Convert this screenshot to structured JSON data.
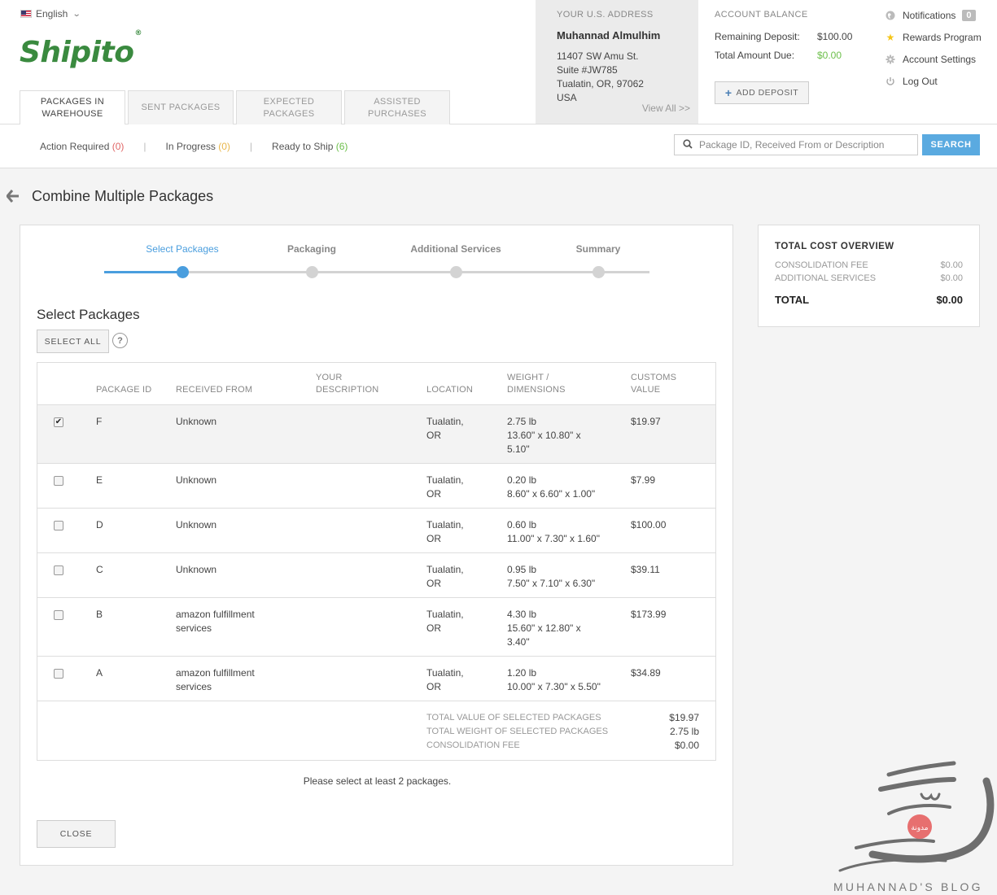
{
  "header": {
    "language": "English",
    "logo_text": "Shipito",
    "tabs": [
      {
        "label": "PACKAGES IN WAREHOUSE"
      },
      {
        "label": "SENT PACKAGES"
      },
      {
        "label": "EXPECTED PACKAGES"
      },
      {
        "label": "ASSISTED PURCHASES"
      }
    ],
    "address": {
      "label": "YOUR U.S. ADDRESS",
      "name": "Muhannad Almulhim",
      "line1": "11407 SW Amu St.",
      "line2": "Suite #JW785",
      "line3": "Tualatin, OR, 97062",
      "line4": "USA",
      "view_all": "View All >>"
    },
    "balance": {
      "label": "ACCOUNT BALANCE",
      "remaining_label": "Remaining Deposit:",
      "remaining_value": "$100.00",
      "due_label": "Total Amount Due:",
      "due_value": "$0.00",
      "add_deposit": "ADD DEPOSIT"
    },
    "user_menu": {
      "notifications": "Notifications",
      "notifications_count": "0",
      "rewards": "Rewards Program",
      "settings": "Account Settings",
      "logout": "Log Out"
    }
  },
  "subnav": {
    "action_required": "Action Required",
    "action_required_count": "(0)",
    "in_progress": "In Progress",
    "in_progress_count": "(0)",
    "ready_to_ship": "Ready to Ship",
    "ready_to_ship_count": "(6)",
    "separator": "|",
    "search_placeholder": "Package ID, Received From or Description",
    "search_button": "SEARCH"
  },
  "page": {
    "title": "Combine Multiple Packages",
    "steps": [
      "Select Packages",
      "Packaging",
      "Additional Services",
      "Summary"
    ],
    "current_step": 0,
    "section_title": "Select Packages",
    "select_all": "SELECT ALL",
    "help": "?",
    "columns": {
      "package_id": "PACKAGE ID",
      "received_from": "RECEIVED FROM",
      "description": "YOUR DESCRIPTION",
      "location": "LOCATION",
      "weight": "WEIGHT / DIMENSIONS",
      "customs": "CUSTOMS VALUE"
    },
    "packages": [
      {
        "checked": true,
        "id": "F",
        "from1": "Unknown",
        "from2": "",
        "loc1": "Tualatin,",
        "loc2": "OR",
        "w1": "2.75 lb",
        "w2": "13.60\" x 10.80\" x",
        "w3": "5.10\"",
        "value": "$19.97"
      },
      {
        "checked": false,
        "id": "E",
        "from1": "Unknown",
        "from2": "",
        "loc1": "Tualatin,",
        "loc2": "OR",
        "w1": "0.20 lb",
        "w2": "8.60\" x 6.60\" x 1.00\"",
        "w3": "",
        "value": "$7.99"
      },
      {
        "checked": false,
        "id": "D",
        "from1": "Unknown",
        "from2": "",
        "loc1": "Tualatin,",
        "loc2": "OR",
        "w1": "0.60 lb",
        "w2": "11.00\" x 7.30\" x 1.60\"",
        "w3": "",
        "value": "$100.00"
      },
      {
        "checked": false,
        "id": "C",
        "from1": "Unknown",
        "from2": "",
        "loc1": "Tualatin,",
        "loc2": "OR",
        "w1": "0.95 lb",
        "w2": "7.50\" x 7.10\" x 6.30\"",
        "w3": "",
        "value": "$39.11"
      },
      {
        "checked": false,
        "id": "B",
        "from1": "amazon fulfillment",
        "from2": "services",
        "loc1": "Tualatin,",
        "loc2": "OR",
        "w1": "4.30 lb",
        "w2": "15.60\" x 12.80\" x",
        "w3": "3.40\"",
        "value": "$173.99"
      },
      {
        "checked": false,
        "id": "A",
        "from1": "amazon fulfillment",
        "from2": "services",
        "loc1": "Tualatin,",
        "loc2": "OR",
        "w1": "1.20 lb",
        "w2": "10.00\" x 7.30\" x 5.50\"",
        "w3": "",
        "value": "$34.89"
      }
    ],
    "summary": {
      "total_value_label": "TOTAL VALUE OF SELECTED PACKAGES",
      "total_value": "$19.97",
      "total_weight_label": "TOTAL WEIGHT OF SELECTED PACKAGES",
      "total_weight": "2.75 lb",
      "fee_label": "CONSOLIDATION FEE",
      "fee": "$0.00"
    },
    "notice": "Please select at least 2 packages.",
    "close": "CLOSE"
  },
  "cost_overview": {
    "title": "TOTAL COST OVERVIEW",
    "consolidation_label": "CONSOLIDATION FEE",
    "consolidation_value": "$0.00",
    "additional_label": "ADDITIONAL SERVICES",
    "additional_value": "$0.00",
    "total_label": "TOTAL",
    "total_value": "$0.00"
  },
  "watermark": {
    "caption": "MUHANNAD'S BLOG",
    "badge_text": "مدونة"
  },
  "colors": {
    "brand_green": "#3a8a3f",
    "accent_blue": "#4a9ede",
    "search_blue": "#5aaae0",
    "success_green": "#6cbf4a",
    "warning_yellow": "#e8b64a",
    "danger_red": "#e06666"
  }
}
